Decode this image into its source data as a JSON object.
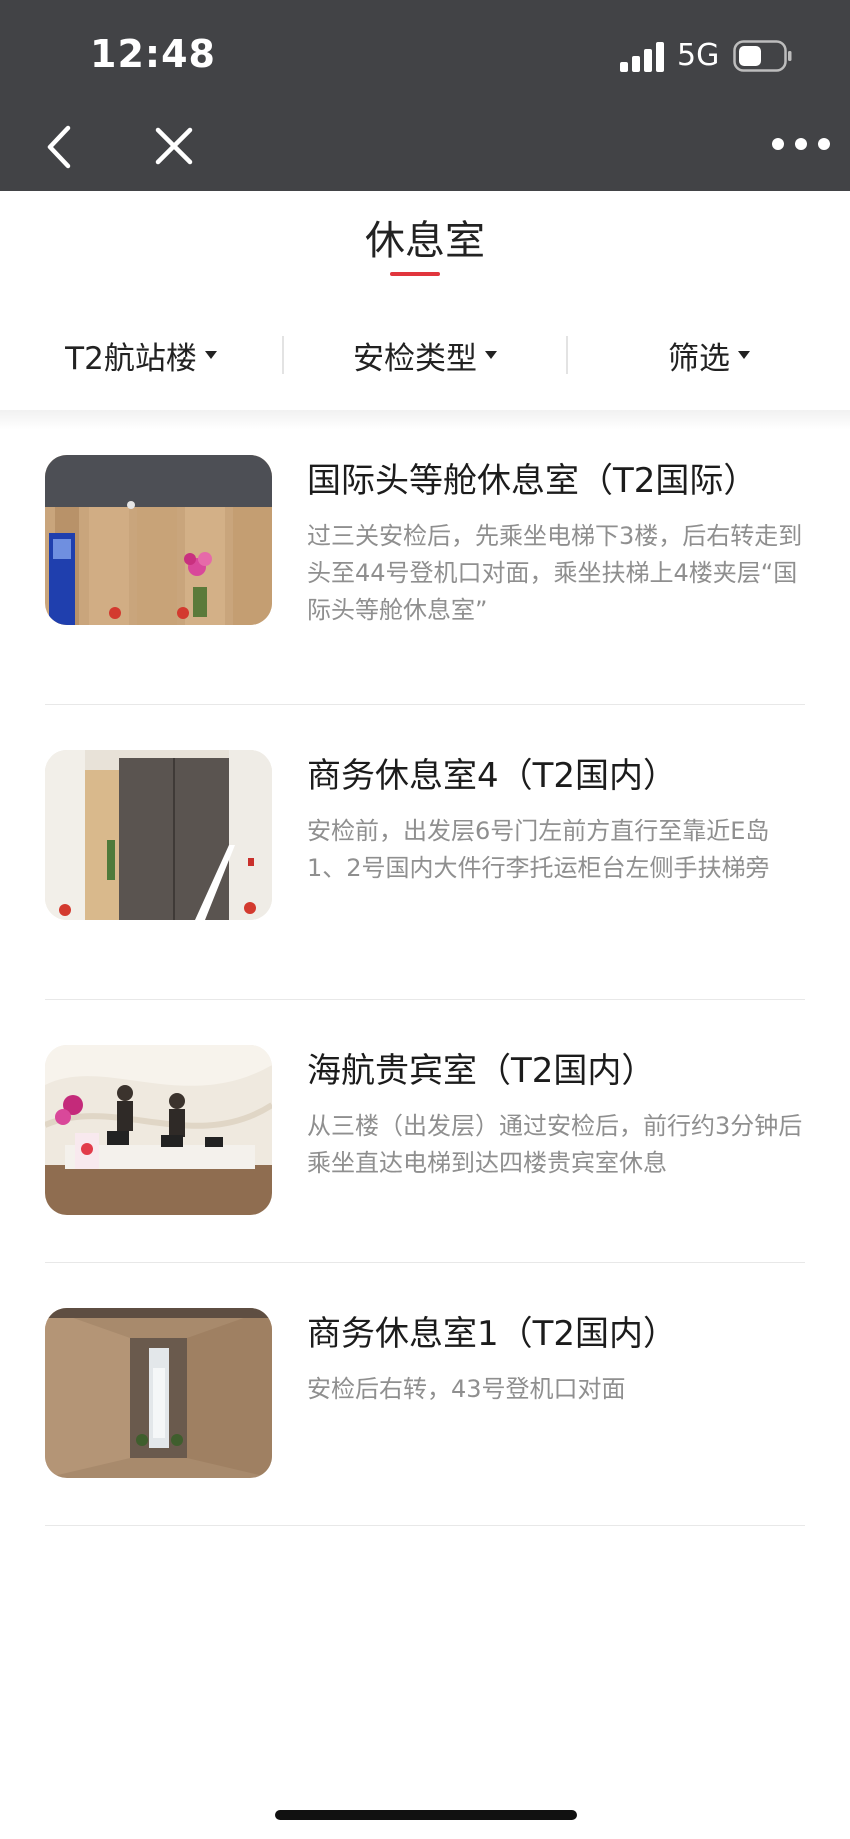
{
  "status_bar": {
    "time": "12:48",
    "network": "5G",
    "signal_icon": "cellular-signal-icon",
    "battery_icon": "battery-icon"
  },
  "nav": {
    "back_icon": "chevron-left-icon",
    "close_icon": "close-icon",
    "more_icon": "more-dots-icon"
  },
  "page": {
    "title": "休息室"
  },
  "filters": [
    {
      "label": "T2航站楼"
    },
    {
      "label": "安检类型"
    },
    {
      "label": "筛选"
    }
  ],
  "lounges": [
    {
      "name": "国际头等舱休息室（T2国际）",
      "description": "过三关安检后，先乘坐电梯下3楼，后右转走到头至44号登机口对面，乘坐扶梯上4楼夹层“国际头等舱休息室”",
      "image": "corridor-with-flowers-photo"
    },
    {
      "name": "商务休息室4（T2国内）",
      "description": "安检前，出发层6号门左前方直行至靠近E岛1、2号国内大件行李托运柜台左侧手扶梯旁",
      "image": "lounge-entrance-door-photo"
    },
    {
      "name": "海航贵宾室（T2国内）",
      "description": "从三楼（出发层）通过安检后，前行约3分钟后乘坐直达电梯到达四楼贵宾室休息",
      "image": "reception-desk-photo"
    },
    {
      "name": "商务休息室1（T2国内）",
      "description": "安检后右转，43号登机口对面",
      "image": "hallway-photo"
    }
  ],
  "colors": {
    "top_bar": "#424346",
    "accent_red": "#e1353d",
    "description_text": "#8f8f8f"
  }
}
